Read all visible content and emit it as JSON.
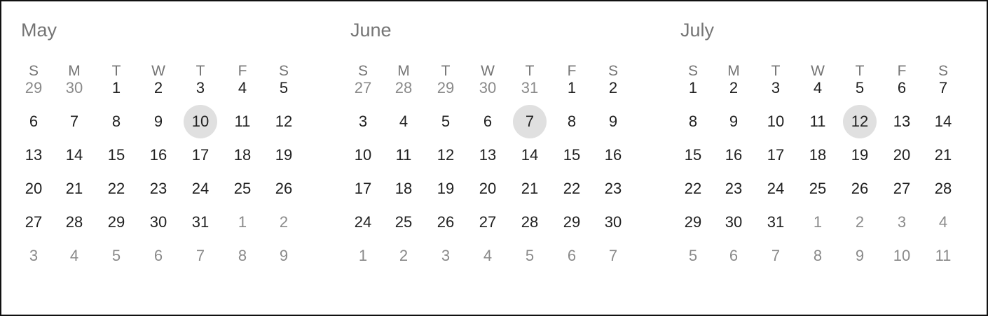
{
  "weekday_labels": [
    "S",
    "M",
    "T",
    "W",
    "T",
    "F",
    "S"
  ],
  "months": [
    {
      "name": "May",
      "selected_day": "10",
      "weeks": [
        [
          [
            "29",
            0
          ],
          [
            "30",
            0
          ],
          [
            "1",
            1
          ],
          [
            "2",
            1
          ],
          [
            "3",
            1
          ],
          [
            "4",
            1
          ],
          [
            "5",
            1
          ]
        ],
        [
          [
            "6",
            1
          ],
          [
            "7",
            1
          ],
          [
            "8",
            1
          ],
          [
            "9",
            1
          ],
          [
            "10",
            1
          ],
          [
            "11",
            1
          ],
          [
            "12",
            1
          ]
        ],
        [
          [
            "13",
            1
          ],
          [
            "14",
            1
          ],
          [
            "15",
            1
          ],
          [
            "16",
            1
          ],
          [
            "17",
            1
          ],
          [
            "18",
            1
          ],
          [
            "19",
            1
          ]
        ],
        [
          [
            "20",
            1
          ],
          [
            "21",
            1
          ],
          [
            "22",
            1
          ],
          [
            "23",
            1
          ],
          [
            "24",
            1
          ],
          [
            "25",
            1
          ],
          [
            "26",
            1
          ]
        ],
        [
          [
            "27",
            1
          ],
          [
            "28",
            1
          ],
          [
            "29",
            1
          ],
          [
            "30",
            1
          ],
          [
            "31",
            1
          ],
          [
            "1",
            0
          ],
          [
            "2",
            0
          ]
        ],
        [
          [
            "3",
            0
          ],
          [
            "4",
            0
          ],
          [
            "5",
            0
          ],
          [
            "6",
            0
          ],
          [
            "7",
            0
          ],
          [
            "8",
            0
          ],
          [
            "9",
            0
          ]
        ]
      ]
    },
    {
      "name": "June",
      "selected_day": "7",
      "weeks": [
        [
          [
            "27",
            0
          ],
          [
            "28",
            0
          ],
          [
            "29",
            0
          ],
          [
            "30",
            0
          ],
          [
            "31",
            0
          ],
          [
            "1",
            1
          ],
          [
            "2",
            1
          ]
        ],
        [
          [
            "3",
            1
          ],
          [
            "4",
            1
          ],
          [
            "5",
            1
          ],
          [
            "6",
            1
          ],
          [
            "7",
            1
          ],
          [
            "8",
            1
          ],
          [
            "9",
            1
          ]
        ],
        [
          [
            "10",
            1
          ],
          [
            "11",
            1
          ],
          [
            "12",
            1
          ],
          [
            "13",
            1
          ],
          [
            "14",
            1
          ],
          [
            "15",
            1
          ],
          [
            "16",
            1
          ]
        ],
        [
          [
            "17",
            1
          ],
          [
            "18",
            1
          ],
          [
            "19",
            1
          ],
          [
            "20",
            1
          ],
          [
            "21",
            1
          ],
          [
            "22",
            1
          ],
          [
            "23",
            1
          ]
        ],
        [
          [
            "24",
            1
          ],
          [
            "25",
            1
          ],
          [
            "26",
            1
          ],
          [
            "27",
            1
          ],
          [
            "28",
            1
          ],
          [
            "29",
            1
          ],
          [
            "30",
            1
          ]
        ],
        [
          [
            "1",
            0
          ],
          [
            "2",
            0
          ],
          [
            "3",
            0
          ],
          [
            "4",
            0
          ],
          [
            "5",
            0
          ],
          [
            "6",
            0
          ],
          [
            "7",
            0
          ]
        ]
      ]
    },
    {
      "name": "July",
      "selected_day": "12",
      "weeks": [
        [
          [
            "1",
            1
          ],
          [
            "2",
            1
          ],
          [
            "3",
            1
          ],
          [
            "4",
            1
          ],
          [
            "5",
            1
          ],
          [
            "6",
            1
          ],
          [
            "7",
            1
          ]
        ],
        [
          [
            "8",
            1
          ],
          [
            "9",
            1
          ],
          [
            "10",
            1
          ],
          [
            "11",
            1
          ],
          [
            "12",
            1
          ],
          [
            "13",
            1
          ],
          [
            "14",
            1
          ]
        ],
        [
          [
            "15",
            1
          ],
          [
            "16",
            1
          ],
          [
            "17",
            1
          ],
          [
            "18",
            1
          ],
          [
            "19",
            1
          ],
          [
            "20",
            1
          ],
          [
            "21",
            1
          ]
        ],
        [
          [
            "22",
            1
          ],
          [
            "23",
            1
          ],
          [
            "24",
            1
          ],
          [
            "25",
            1
          ],
          [
            "26",
            1
          ],
          [
            "27",
            1
          ],
          [
            "28",
            1
          ]
        ],
        [
          [
            "29",
            1
          ],
          [
            "30",
            1
          ],
          [
            "31",
            1
          ],
          [
            "1",
            0
          ],
          [
            "2",
            0
          ],
          [
            "3",
            0
          ],
          [
            "4",
            0
          ]
        ],
        [
          [
            "5",
            0
          ],
          [
            "6",
            0
          ],
          [
            "7",
            0
          ],
          [
            "8",
            0
          ],
          [
            "9",
            0
          ],
          [
            "10",
            0
          ],
          [
            "11",
            0
          ]
        ]
      ]
    }
  ],
  "colors": {
    "day_text": "#212121",
    "muted_text": "#8a8a8a",
    "header_text": "#757575",
    "selected_bg": "#e0e0e0",
    "border": "#111111"
  }
}
